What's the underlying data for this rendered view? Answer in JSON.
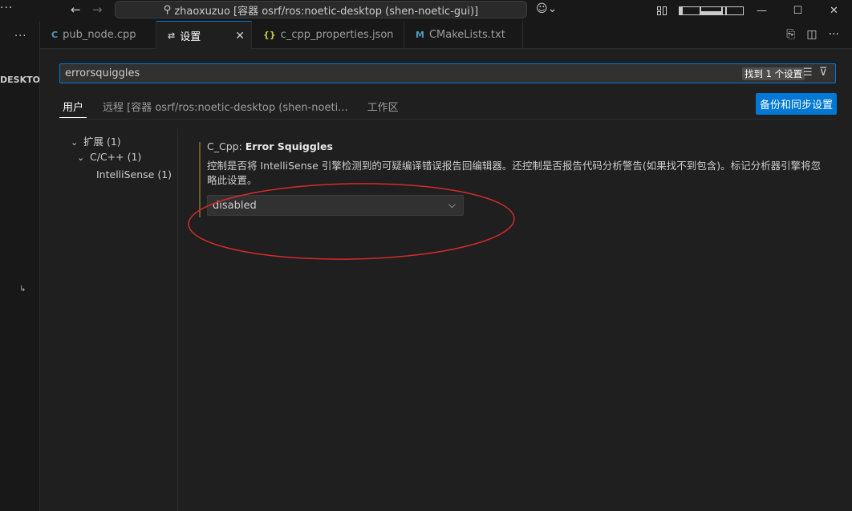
{
  "titlebar": {
    "command_center_text": "zhaoxuzuo [容器 osrf/ros:noetic-desktop (shen-noetic-gui)]",
    "menu_dots": "···"
  },
  "sidebar": {
    "dots": "···",
    "section_label": "DESKTO..."
  },
  "tabs": [
    {
      "label": "pub_node.cpp",
      "icon": "C"
    },
    {
      "label": "设置",
      "icon": "⇄"
    },
    {
      "label": "c_cpp_properties.json",
      "icon": "{}"
    },
    {
      "label": "CMakeLists.txt",
      "icon": "M"
    }
  ],
  "settings": {
    "search_value": "errorsquiggles",
    "found_badge": "找到 1 个设置",
    "scopes": [
      "用户",
      "远程 [容器 osrf/ros:noetic-desktop (shen-noeti...",
      "工作区"
    ],
    "sync_button": "备份和同步设置",
    "toc": [
      {
        "label": "扩展 (1)"
      },
      {
        "label": "C/C++ (1)"
      },
      {
        "label": "IntelliSense (1)"
      }
    ],
    "setting": {
      "category": "C_Cpp: ",
      "name": "Error Squiggles",
      "description": "控制是否将 IntelliSense 引擎检测到的可疑编译错误报告回编辑器。还控制是否报告代码分析警告(如果找不到包含)。标记分析器引擎将忽略此设置。",
      "value": "disabled"
    }
  },
  "colors": {
    "accent": "#0078d4",
    "annotation": "#d42b2b"
  }
}
